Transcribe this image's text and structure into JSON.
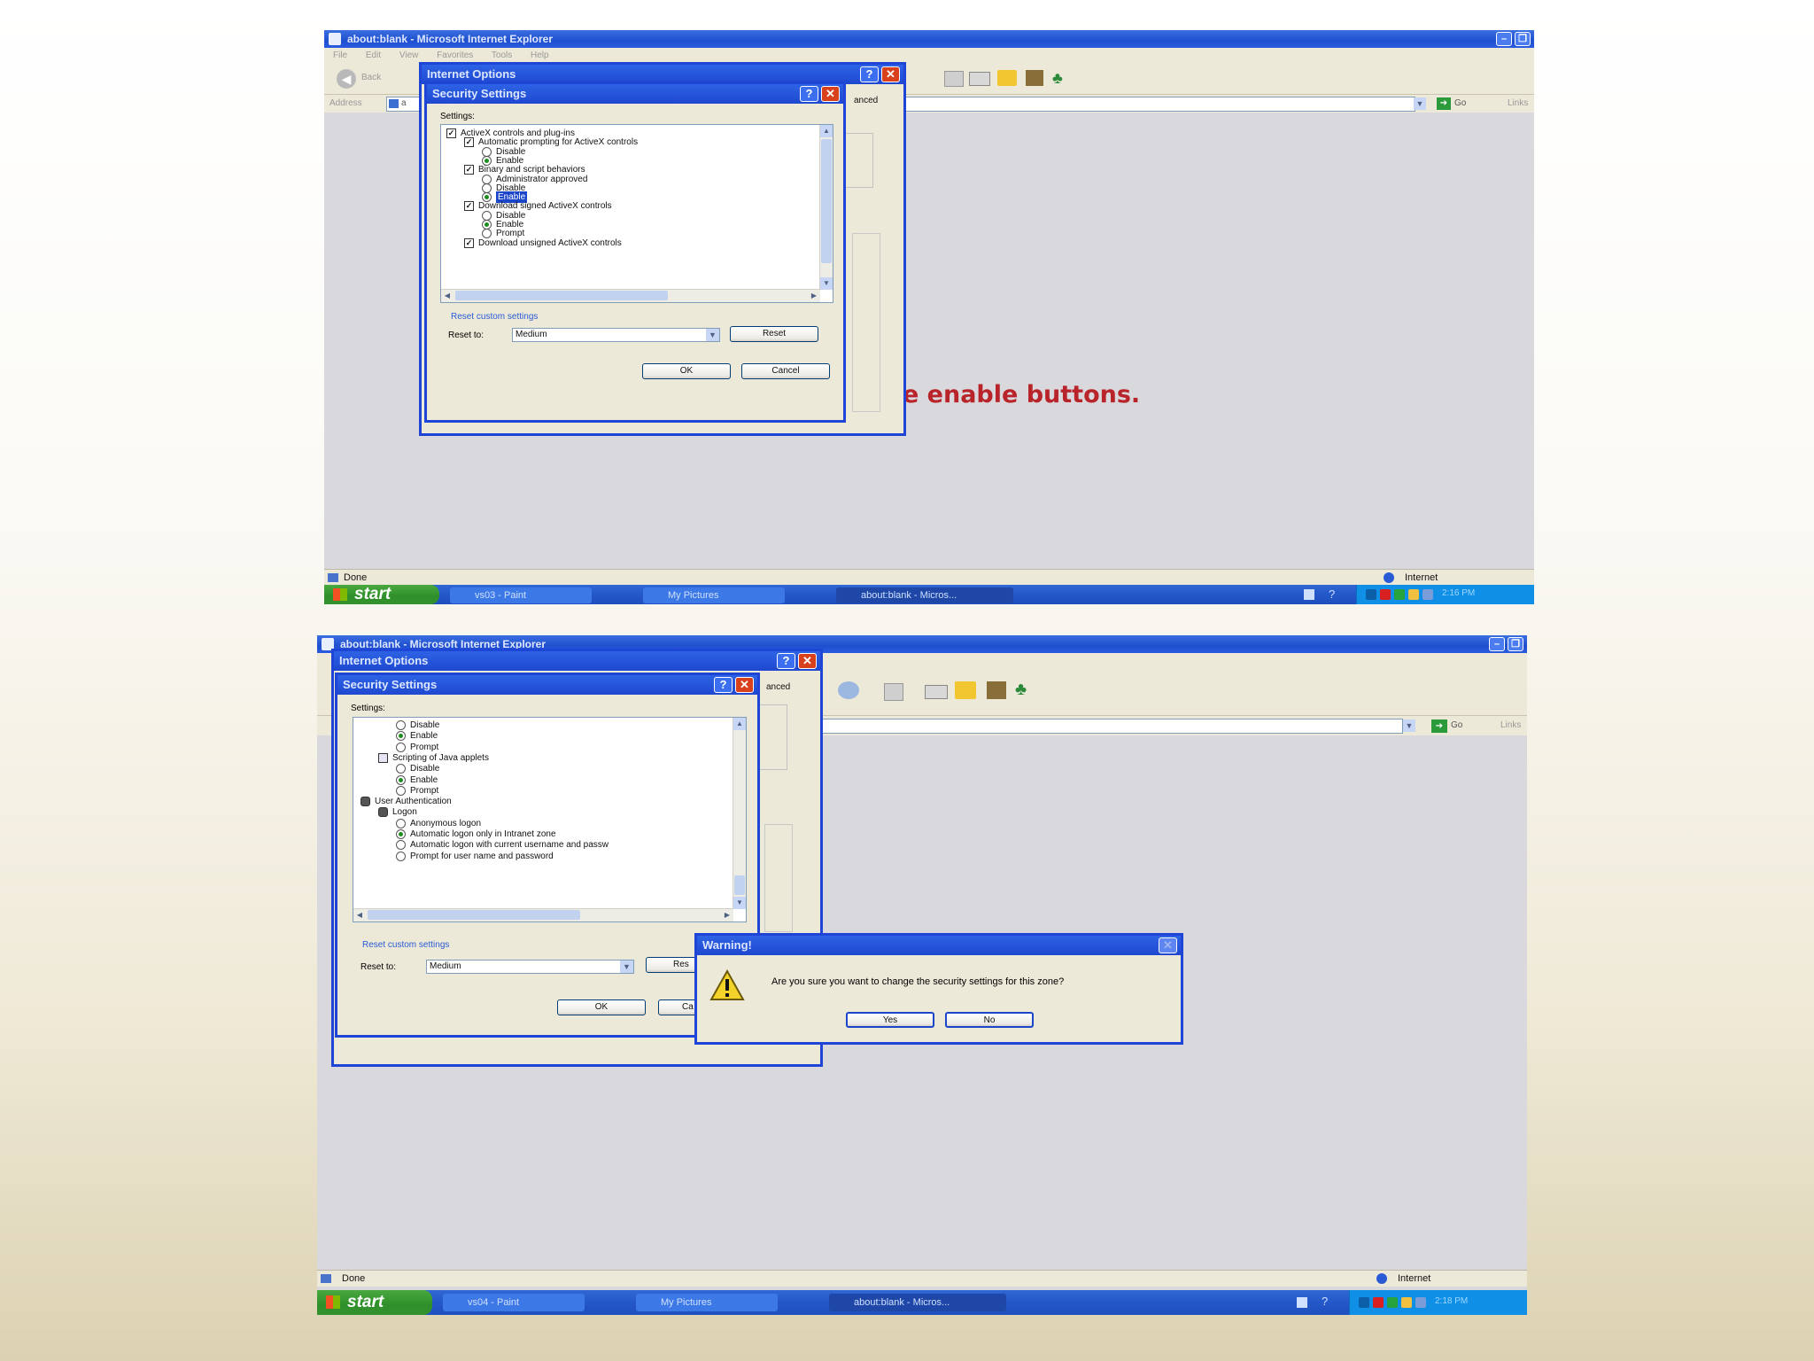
{
  "top": {
    "ie_title": "about:blank - Microsoft Internet Explorer",
    "menu": "File  Edit  View  Favorites  Tools  Help",
    "back_label": "Back",
    "address_label": "Address",
    "address_value": "a",
    "go_label": "Go",
    "links_label": "Links",
    "options_title": "Internet Options",
    "options_tab_fragment": "anced",
    "security_title": "Security Settings",
    "settings_label": "Settings:",
    "tree": [
      {
        "kind": "check",
        "level": 0,
        "text": "ActiveX controls and plug-ins"
      },
      {
        "kind": "check",
        "level": 1,
        "text": "Automatic prompting for ActiveX controls"
      },
      {
        "kind": "radio",
        "level": 2,
        "text": "Disable",
        "selected": false
      },
      {
        "kind": "radio",
        "level": 2,
        "text": "Enable",
        "selected": true
      },
      {
        "kind": "check",
        "level": 1,
        "text": "Binary and script behaviors"
      },
      {
        "kind": "radio",
        "level": 2,
        "text": "Administrator approved",
        "selected": false
      },
      {
        "kind": "radio",
        "level": 2,
        "text": "Disable",
        "selected": false
      },
      {
        "kind": "radio",
        "level": 2,
        "text": "Enable",
        "selected": true,
        "highlighted": true
      },
      {
        "kind": "check",
        "level": 1,
        "text": "Download signed ActiveX controls"
      },
      {
        "kind": "radio",
        "level": 2,
        "text": "Disable",
        "selected": false
      },
      {
        "kind": "radio",
        "level": 2,
        "text": "Enable",
        "selected": true
      },
      {
        "kind": "radio",
        "level": 2,
        "text": "Prompt",
        "selected": false
      },
      {
        "kind": "check",
        "level": 1,
        "text": "Download unsigned ActiveX controls"
      }
    ],
    "reset_custom_label": "Reset custom settings",
    "reset_to_label": "Reset to:",
    "reset_to_value": "Medium",
    "reset_button": "Reset",
    "ok_button": "OK",
    "cancel_button": "Cancel",
    "caption": "Check all the enable buttons.",
    "status_done": "Done",
    "status_zone": "Internet",
    "start_label": "start",
    "task_paint": "vs03 - Paint",
    "task_pictures": "My Pictures",
    "task_ie": "about:blank - Micros...",
    "clock": "2:16 PM"
  },
  "bottom": {
    "ie_title": "about:blank - Microsoft Internet Explorer",
    "go_label": "Go",
    "links_label": "Links",
    "options_title": "Internet Options",
    "options_tab_fragment": "anced",
    "security_title": "Security Settings",
    "settings_label": "Settings:",
    "tree": [
      {
        "kind": "radio",
        "level": 2,
        "text": "Disable",
        "selected": false
      },
      {
        "kind": "radio",
        "level": 2,
        "text": "Enable",
        "selected": true
      },
      {
        "kind": "radio",
        "level": 2,
        "text": "Prompt",
        "selected": false
      },
      {
        "kind": "script",
        "level": 1,
        "text": "Scripting of Java applets"
      },
      {
        "kind": "radio",
        "level": 2,
        "text": "Disable",
        "selected": false
      },
      {
        "kind": "radio",
        "level": 2,
        "text": "Enable",
        "selected": true
      },
      {
        "kind": "radio",
        "level": 2,
        "text": "Prompt",
        "selected": false
      },
      {
        "kind": "user",
        "level": 0,
        "text": "User Authentication"
      },
      {
        "kind": "user",
        "level": 1,
        "text": "Logon"
      },
      {
        "kind": "radio",
        "level": 2,
        "text": "Anonymous logon",
        "selected": false
      },
      {
        "kind": "radio",
        "level": 2,
        "text": "Automatic logon only in Intranet zone",
        "selected": true
      },
      {
        "kind": "radio",
        "level": 2,
        "text": "Automatic logon with current username and passw",
        "selected": false
      },
      {
        "kind": "radio",
        "level": 2,
        "text": "Prompt for user name and password",
        "selected": false
      }
    ],
    "reset_custom_label": "Reset custom settings",
    "reset_to_label": "Reset to:",
    "reset_to_value": "Medium",
    "reset_button_fragment": "Res",
    "ok_button": "OK",
    "cancel_button_fragment": "Ca",
    "warning_title": "Warning!",
    "warning_message": "Are you sure you want to change the security settings for this zone?",
    "yes_button": "Yes",
    "no_button": "No",
    "status_done": "Done",
    "status_zone": "Internet",
    "start_label": "start",
    "task_paint": "vs04 - Paint",
    "task_pictures": "My Pictures",
    "task_ie": "about:blank - Micros...",
    "clock": "2:18 PM"
  },
  "colors": {
    "caption": "#b8242a",
    "titlebar": "#1f4fcf",
    "taskbar": "#2457c8",
    "start_button": "#2f8f2a",
    "dialog_bg": "#ece9d8"
  }
}
